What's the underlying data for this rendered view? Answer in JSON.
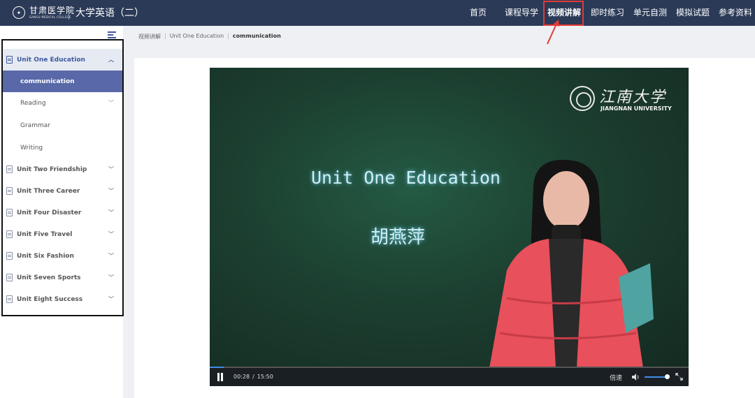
{
  "header": {
    "logo": {
      "cn": "甘肃医学院",
      "en": "GANSU MEDICAL COLLEGE"
    },
    "app_title": "大学英语（二）",
    "nav": [
      {
        "label": "首页",
        "active": false
      },
      {
        "label": "课程导学",
        "active": false
      },
      {
        "label": "视频讲解",
        "active": true
      },
      {
        "label": "即时练习",
        "active": false
      },
      {
        "label": "单元自测",
        "active": false
      },
      {
        "label": "模拟试题",
        "active": false
      },
      {
        "label": "参考资料",
        "active": false
      }
    ]
  },
  "sidebar": {
    "units": [
      {
        "label": "Unit One Education",
        "expanded": true,
        "children": [
          {
            "label": "communication",
            "active": true
          },
          {
            "label": "Reading",
            "has_children": true
          },
          {
            "label": "Grammar"
          },
          {
            "label": "Writing"
          }
        ]
      },
      {
        "label": "Unit Two Friendship"
      },
      {
        "label": "Unit Three Career"
      },
      {
        "label": "Unit Four Disaster"
      },
      {
        "label": "Unit Five Travel"
      },
      {
        "label": "Unit Six Fashion"
      },
      {
        "label": "Unit Seven Sports"
      },
      {
        "label": "Unit Eight Success"
      }
    ]
  },
  "breadcrumb": [
    "视频讲解",
    "Unit One Education",
    "communication"
  ],
  "video": {
    "university_cn": "江南大学",
    "university_en": "JIANGNAN UNIVERSITY",
    "slide_title": "Unit One Education",
    "presenter": "胡燕萍",
    "current_time": "00:28",
    "time_separator": "/",
    "duration": "15:50",
    "progress_fraction": 0.0295,
    "speed_label": "倍速",
    "volume_fraction": 0.9
  },
  "colors": {
    "header_bg": "#2b3a57",
    "accent": "#3e5a9e",
    "active_sub_bg": "#5868a8",
    "annotation_red": "#e53935"
  }
}
